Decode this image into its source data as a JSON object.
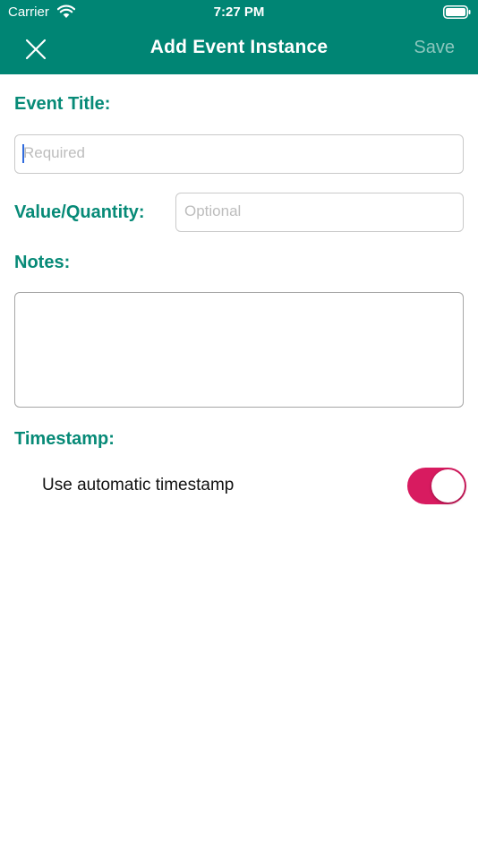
{
  "status_bar": {
    "carrier": "Carrier",
    "time": "7:27 PM"
  },
  "nav": {
    "title": "Add Event Instance",
    "save_label": "Save",
    "close_icon": "close-icon"
  },
  "form": {
    "event_title_label": "Event Title:",
    "event_title_placeholder": "Required",
    "event_title_value": "",
    "quantity_label": "Value/Quantity:",
    "quantity_placeholder": "Optional",
    "quantity_value": "",
    "notes_label": "Notes:",
    "notes_value": "",
    "timestamp_label": "Timestamp:",
    "auto_timestamp_label": "Use automatic timestamp",
    "auto_timestamp_on": true
  },
  "colors": {
    "header": "#008574",
    "label": "#078a77",
    "toggle_on": "#d81b60",
    "save_disabled": "#8ac6bd"
  }
}
